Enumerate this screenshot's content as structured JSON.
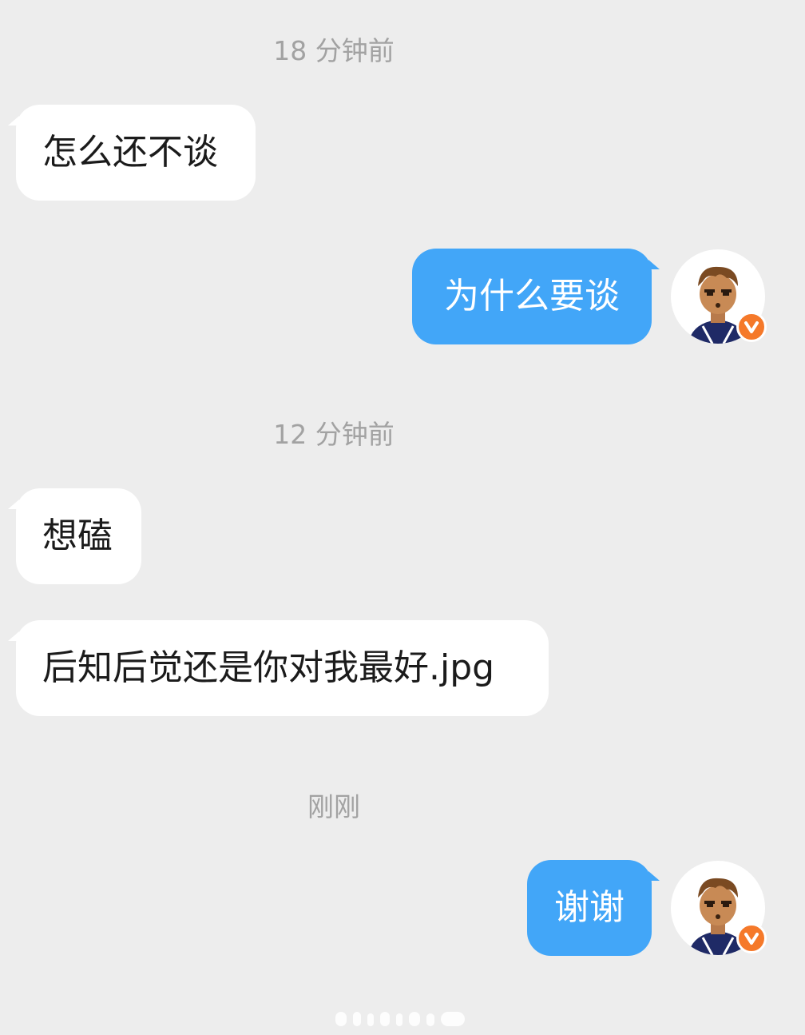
{
  "conversation": [
    {
      "type": "timestamp",
      "text": "18 分钟前"
    },
    {
      "type": "message",
      "direction": "incoming",
      "text": "怎么还不谈"
    },
    {
      "type": "message",
      "direction": "outgoing",
      "text": "为什么要谈"
    },
    {
      "type": "timestamp",
      "text": "12 分钟前"
    },
    {
      "type": "message",
      "direction": "incoming",
      "text": "想磕"
    },
    {
      "type": "message",
      "direction": "incoming",
      "text": "后知后觉还是你对我最好.jpg"
    },
    {
      "type": "timestamp",
      "text": "刚刚"
    },
    {
      "type": "message",
      "direction": "outgoing",
      "text": "谢谢"
    }
  ],
  "avatar": {
    "icon": "cartoon-boy-avatar-icon",
    "badge_icon": "verified-v-badge-icon"
  },
  "colors": {
    "background": "#ededed",
    "incoming_bubble": "#ffffff",
    "outgoing_bubble": "#42a6f8",
    "timestamp_text": "#a2a2a2",
    "badge": "#f5792a"
  }
}
